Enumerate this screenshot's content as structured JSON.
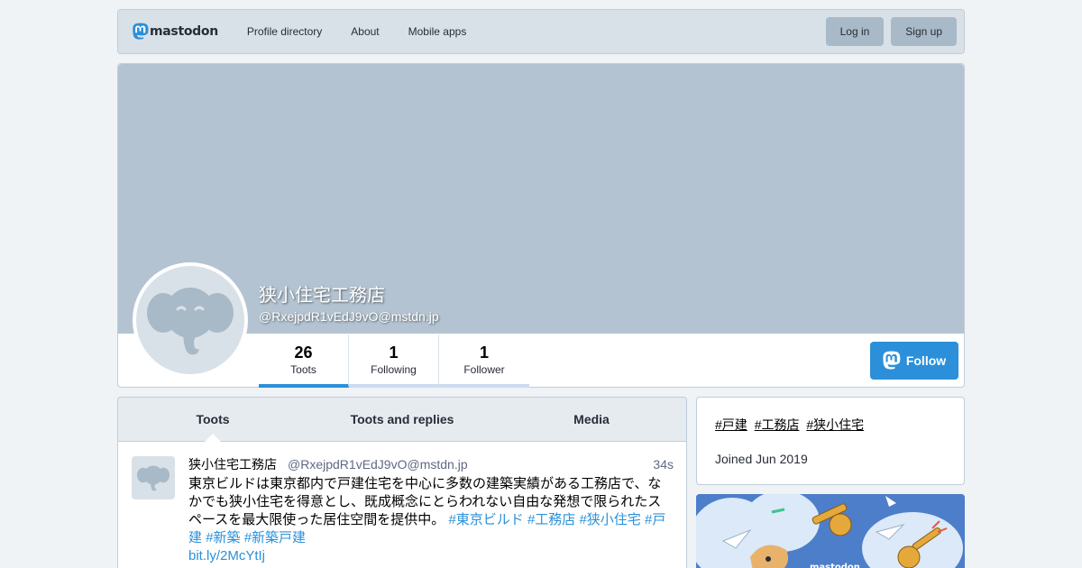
{
  "nav": {
    "logo_text": "mastodon",
    "links": [
      "Profile directory",
      "About",
      "Mobile apps"
    ],
    "login": "Log in",
    "signup": "Sign up"
  },
  "profile": {
    "display_name": "狭小住宅工務店",
    "handle": "@RxejpdR1vEdJ9vO@mstdn.jp",
    "counters": [
      {
        "value": "26",
        "label": "Toots"
      },
      {
        "value": "1",
        "label": "Following"
      },
      {
        "value": "1",
        "label": "Follower"
      }
    ],
    "follow": "Follow"
  },
  "tabs": [
    "Toots",
    "Toots and replies",
    "Media"
  ],
  "status": {
    "name": "狭小住宅工務店",
    "acct": "@RxejpdR1vEdJ9vO@mstdn.jp",
    "time": "34s",
    "text": "東京ビルドは東京都内で戸建住宅を中心に多数の建築実績がある工務店で、なかでも狭小住宅を得意とし、既成概念にとらわれない自由な発想で限られたスペースを最大限使った居住空間を提供中。",
    "hashtags": [
      "#東京ビルド",
      "#工務店",
      "#狭小住宅",
      "#戸建",
      "#新築",
      "#新築戸建"
    ],
    "link": "bit.ly/2McYtIj"
  },
  "sidebar": {
    "tags": [
      "#戸建",
      "#工務店",
      "#狭小住宅"
    ],
    "joined": "Joined Jun 2019",
    "promo_logo": "mastodon"
  },
  "colors": {
    "accent": "#2b90d9",
    "nav_bg": "#d9e1e8",
    "cover": "#b3c3d1"
  }
}
